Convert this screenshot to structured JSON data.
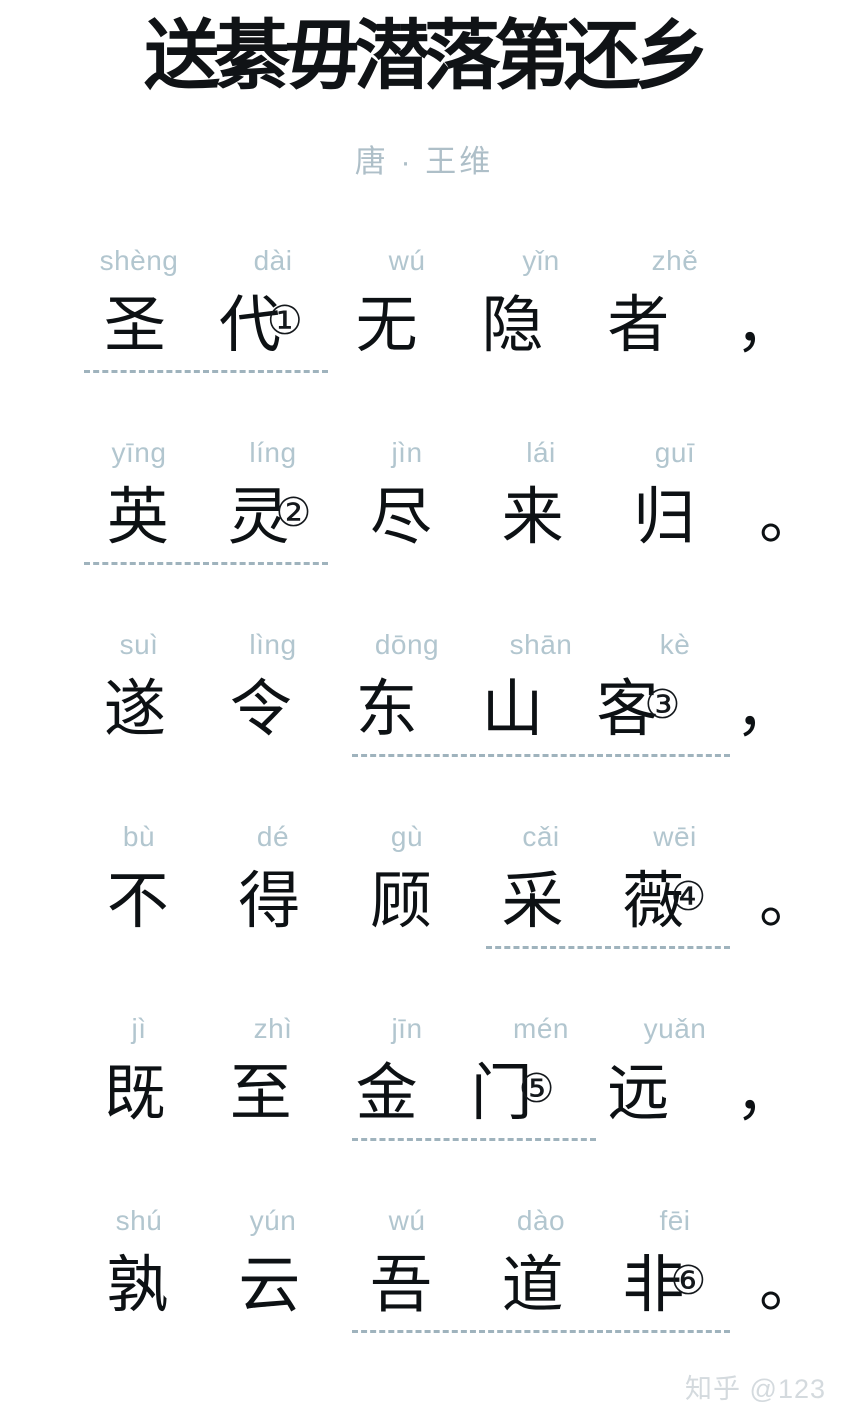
{
  "header": {
    "title": "送綦毋潜落第还乡",
    "subtitle": "唐 · 王维"
  },
  "watermark": "知乎 @123",
  "colors": {
    "background": "#ffffff",
    "title_text": "#101316",
    "subtitle_text": "#aebfc8",
    "pinyin_text": "#b2c6cf",
    "han_text": "#0d1114",
    "dashed_underline": "#9fb3bd",
    "watermark_text": "#d4dade"
  },
  "poem": {
    "lines": [
      {
        "pinyin": [
          "shèng",
          "dài",
          "wú",
          "yǐn",
          "zhě"
        ],
        "chars": [
          "圣",
          "代",
          "无",
          "隐",
          "者"
        ],
        "marker": "①",
        "marker_after_index": 1,
        "punctuation": "，",
        "underline_from": 0,
        "underline_to": 1
      },
      {
        "pinyin": [
          "yīng",
          "líng",
          "jìn",
          "lái",
          "guī"
        ],
        "chars": [
          "英",
          "灵",
          "尽",
          "来",
          "归"
        ],
        "marker": "②",
        "marker_after_index": 1,
        "punctuation": "。",
        "underline_from": 0,
        "underline_to": 1
      },
      {
        "pinyin": [
          "suì",
          "lìng",
          "dōng",
          "shān",
          "kè"
        ],
        "chars": [
          "遂",
          "令",
          "东",
          "山",
          "客"
        ],
        "marker": "③",
        "marker_after_index": 4,
        "punctuation": "，",
        "underline_from": 2,
        "underline_to": 4
      },
      {
        "pinyin": [
          "bù",
          "dé",
          "gù",
          "cǎi",
          "wēi"
        ],
        "chars": [
          "不",
          "得",
          "顾",
          "采",
          "薇"
        ],
        "marker": "④",
        "marker_after_index": 4,
        "punctuation": "。",
        "underline_from": 3,
        "underline_to": 4
      },
      {
        "pinyin": [
          "jì",
          "zhì",
          "jīn",
          "mén",
          "yuǎn"
        ],
        "chars": [
          "既",
          "至",
          "金",
          "门",
          "远"
        ],
        "marker": "⑤",
        "marker_after_index": 3,
        "punctuation": "，",
        "underline_from": 2,
        "underline_to": 3
      },
      {
        "pinyin": [
          "shú",
          "yún",
          "wú",
          "dào",
          "fēi"
        ],
        "chars": [
          "孰",
          "云",
          "吾",
          "道",
          "非"
        ],
        "marker": "⑥",
        "marker_after_index": 4,
        "punctuation": "。",
        "underline_from": 2,
        "underline_to": 4
      }
    ]
  }
}
